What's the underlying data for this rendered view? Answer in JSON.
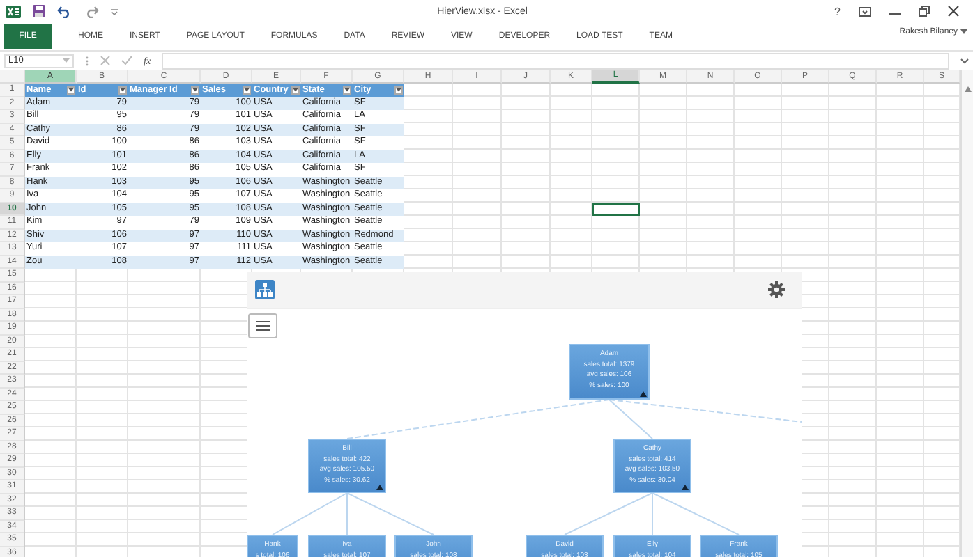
{
  "window": {
    "title": "HierView.xlsx - Excel",
    "help": "?",
    "user": "Rakesh Bilaney"
  },
  "ribbon_tabs": [
    {
      "label": "FILE",
      "kind": "backstage"
    },
    {
      "label": "HOME",
      "kind": "tab"
    },
    {
      "label": "INSERT",
      "kind": "tab"
    },
    {
      "label": "PAGE LAYOUT",
      "kind": "tab"
    },
    {
      "label": "FORMULAS",
      "kind": "tab"
    },
    {
      "label": "DATA",
      "kind": "tab"
    },
    {
      "label": "REVIEW",
      "kind": "tab"
    },
    {
      "label": "VIEW",
      "kind": "tab"
    },
    {
      "label": "DEVELOPER",
      "kind": "tab"
    },
    {
      "label": "LOAD TEST",
      "kind": "tab"
    },
    {
      "label": "TEAM",
      "kind": "tab"
    }
  ],
  "formula_bar": {
    "name_box": "L10",
    "function_label": "fx"
  },
  "columns": [
    {
      "label": "A",
      "selected": false,
      "highlighted": true
    },
    {
      "label": "B",
      "selected": false,
      "highlighted": false
    },
    {
      "label": "C",
      "selected": false,
      "highlighted": false
    },
    {
      "label": "D",
      "selected": false,
      "highlighted": false
    },
    {
      "label": "E",
      "selected": false,
      "highlighted": false
    },
    {
      "label": "F",
      "selected": false,
      "highlighted": false
    },
    {
      "label": "G",
      "selected": false,
      "highlighted": false
    },
    {
      "label": "H",
      "selected": false,
      "highlighted": false
    },
    {
      "label": "I",
      "selected": false,
      "highlighted": false
    },
    {
      "label": "J",
      "selected": false,
      "highlighted": false
    },
    {
      "label": "K",
      "selected": false,
      "highlighted": false
    },
    {
      "label": "L",
      "selected": true,
      "highlighted": false
    },
    {
      "label": "M",
      "selected": false,
      "highlighted": false
    },
    {
      "label": "N",
      "selected": false,
      "highlighted": false
    },
    {
      "label": "O",
      "selected": false,
      "highlighted": false
    },
    {
      "label": "P",
      "selected": false,
      "highlighted": false
    },
    {
      "label": "Q",
      "selected": false,
      "highlighted": false
    },
    {
      "label": "R",
      "selected": false,
      "highlighted": false
    },
    {
      "label": "S",
      "selected": false,
      "highlighted": false
    }
  ],
  "rows": [
    {
      "label": "1",
      "selected": false
    },
    {
      "label": "2",
      "selected": false
    },
    {
      "label": "3",
      "selected": false
    },
    {
      "label": "4",
      "selected": false
    },
    {
      "label": "5",
      "selected": false
    },
    {
      "label": "6",
      "selected": false
    },
    {
      "label": "7",
      "selected": false
    },
    {
      "label": "8",
      "selected": false
    },
    {
      "label": "9",
      "selected": false
    },
    {
      "label": "10",
      "selected": true
    },
    {
      "label": "11",
      "selected": false
    },
    {
      "label": "12",
      "selected": false
    },
    {
      "label": "13",
      "selected": false
    },
    {
      "label": "14",
      "selected": false
    },
    {
      "label": "15",
      "selected": false
    },
    {
      "label": "16",
      "selected": false
    },
    {
      "label": "17",
      "selected": false
    },
    {
      "label": "18",
      "selected": false
    },
    {
      "label": "19",
      "selected": false
    },
    {
      "label": "20",
      "selected": false
    },
    {
      "label": "21",
      "selected": false
    },
    {
      "label": "22",
      "selected": false
    },
    {
      "label": "23",
      "selected": false
    },
    {
      "label": "24",
      "selected": false
    },
    {
      "label": "25",
      "selected": false
    },
    {
      "label": "26",
      "selected": false
    },
    {
      "label": "27",
      "selected": false
    },
    {
      "label": "28",
      "selected": false
    },
    {
      "label": "29",
      "selected": false
    },
    {
      "label": "30",
      "selected": false
    },
    {
      "label": "31",
      "selected": false
    },
    {
      "label": "32",
      "selected": false
    },
    {
      "label": "33",
      "selected": false
    },
    {
      "label": "34",
      "selected": false
    },
    {
      "label": "35",
      "selected": false
    },
    {
      "label": "36",
      "selected": false
    }
  ],
  "table": {
    "columns": [
      {
        "label": "Name",
        "kind": "text"
      },
      {
        "label": "Id",
        "kind": "number"
      },
      {
        "label": "Manager Id",
        "kind": "number"
      },
      {
        "label": "Sales",
        "kind": "number"
      },
      {
        "label": "Country",
        "kind": "text"
      },
      {
        "label": "State",
        "kind": "text"
      },
      {
        "label": "City",
        "kind": "text"
      }
    ],
    "rows": [
      [
        "Adam",
        "79",
        "79",
        "100",
        "USA",
        "California",
        "SF"
      ],
      [
        "Bill",
        "95",
        "79",
        "101",
        "USA",
        "California",
        "LA"
      ],
      [
        "Cathy",
        "86",
        "79",
        "102",
        "USA",
        "California",
        "SF"
      ],
      [
        "David",
        "100",
        "86",
        "103",
        "USA",
        "California",
        "SF"
      ],
      [
        "Elly",
        "101",
        "86",
        "104",
        "USA",
        "California",
        "LA"
      ],
      [
        "Frank",
        "102",
        "86",
        "105",
        "USA",
        "California",
        "SF"
      ],
      [
        "Hank",
        "103",
        "95",
        "106",
        "USA",
        "Washington",
        "Seattle"
      ],
      [
        "Iva",
        "104",
        "95",
        "107",
        "USA",
        "Washington",
        "Seattle"
      ],
      [
        "John",
        "105",
        "95",
        "108",
        "USA",
        "Washington",
        "Seattle"
      ],
      [
        "Kim",
        "97",
        "79",
        "109",
        "USA",
        "Washington",
        "Seattle"
      ],
      [
        "Shiv",
        "106",
        "97",
        "110",
        "USA",
        "Washington",
        "Redmond"
      ],
      [
        "Yuri",
        "107",
        "97",
        "111",
        "USA",
        "Washington",
        "Seattle"
      ],
      [
        "Zou",
        "108",
        "97",
        "112",
        "USA",
        "Washington",
        "Seattle"
      ]
    ]
  },
  "hierarchy": {
    "nodes": [
      {
        "name": "Adam",
        "lines": [
          "sales total: 1379",
          "avg sales: 106",
          "% sales: 100"
        ],
        "expanded": true
      },
      {
        "name": "Bill",
        "lines": [
          "sales total: 422",
          "avg sales: 105.50",
          "% sales: 30.62"
        ],
        "expanded": true
      },
      {
        "name": "Cathy",
        "lines": [
          "sales total: 414",
          "avg sales: 103.50",
          "% sales: 30.04"
        ],
        "expanded": true
      },
      {
        "name": "Hank",
        "lines": [
          "s total: 106"
        ]
      },
      {
        "name": "Iva",
        "lines": [
          "sales total: 107"
        ]
      },
      {
        "name": "John",
        "lines": [
          "sales total: 108"
        ]
      },
      {
        "name": "David",
        "lines": [
          "sales total: 103"
        ]
      },
      {
        "name": "Elly",
        "lines": [
          "sales total: 104"
        ]
      },
      {
        "name": "Frank",
        "lines": [
          "sales total: 105"
        ]
      }
    ]
  }
}
